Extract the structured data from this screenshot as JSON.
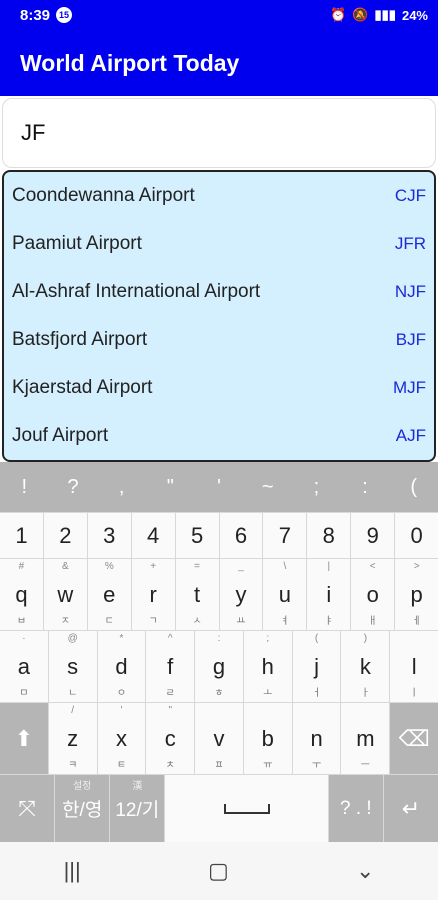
{
  "status": {
    "time": "8:39",
    "badge": "15",
    "battery": "24%"
  },
  "app": {
    "title": "World Airport Today"
  },
  "search": {
    "value": "JF"
  },
  "results": [
    {
      "name": "Coondewanna Airport",
      "code": "CJF"
    },
    {
      "name": "Paamiut Airport",
      "code": "JFR"
    },
    {
      "name": "Al-Ashraf International Airport",
      "code": "NJF"
    },
    {
      "name": "Batsfjord Airport",
      "code": "BJF"
    },
    {
      "name": "Kjaerstad Airport",
      "code": "MJF"
    },
    {
      "name": "Jouf Airport",
      "code": "AJF"
    }
  ],
  "keyboard": {
    "symbols": [
      "!",
      "?",
      ",",
      "\"",
      "'",
      "~",
      ";",
      ":",
      "("
    ],
    "numbers": [
      "1",
      "2",
      "3",
      "4",
      "5",
      "6",
      "7",
      "8",
      "9",
      "0"
    ],
    "row_q": [
      {
        "k": "q",
        "sup": "#",
        "sub": "ㅂ"
      },
      {
        "k": "w",
        "sup": "&",
        "sub": "ㅈ"
      },
      {
        "k": "e",
        "sup": "%",
        "sub": "ㄷ"
      },
      {
        "k": "r",
        "sup": "+",
        "sub": "ㄱ"
      },
      {
        "k": "t",
        "sup": "=",
        "sub": "ㅅ"
      },
      {
        "k": "y",
        "sup": "_",
        "sub": "ㅛ"
      },
      {
        "k": "u",
        "sup": "\\",
        "sub": "ㅕ"
      },
      {
        "k": "i",
        "sup": "|",
        "sub": "ㅑ"
      },
      {
        "k": "o",
        "sup": "<",
        "sub": "ㅐ"
      },
      {
        "k": "p",
        "sup": ">",
        "sub": "ㅔ"
      }
    ],
    "row_a": [
      {
        "k": "a",
        "sup": "·",
        "sub": "ㅁ"
      },
      {
        "k": "s",
        "sup": "@",
        "sub": "ㄴ"
      },
      {
        "k": "d",
        "sup": "*",
        "sub": "ㅇ"
      },
      {
        "k": "f",
        "sup": "^",
        "sub": "ㄹ"
      },
      {
        "k": "g",
        "sup": ":",
        "sub": "ㅎ"
      },
      {
        "k": "h",
        "sup": ";",
        "sub": "ㅗ"
      },
      {
        "k": "j",
        "sup": "(",
        "sub": "ㅓ"
      },
      {
        "k": "k",
        "sup": ")",
        "sub": "ㅏ"
      },
      {
        "k": "l",
        "sup": "",
        "sub": "ㅣ"
      }
    ],
    "row_z": [
      {
        "k": "z",
        "sup": "/",
        "sub": "ㅋ"
      },
      {
        "k": "x",
        "sup": "'",
        "sub": "ㅌ"
      },
      {
        "k": "c",
        "sup": "\"",
        "sub": "ㅊ"
      },
      {
        "k": "v",
        "sup": "",
        "sub": "ㅍ"
      },
      {
        "k": "b",
        "sup": "",
        "sub": "ㅠ"
      },
      {
        "k": "n",
        "sup": "",
        "sub": "ㅜ"
      },
      {
        "k": "m",
        "sup": "",
        "sub": "ㅡ"
      }
    ],
    "lang_key": {
      "top": "설정",
      "label": "한/영"
    },
    "num_key": {
      "top": "漢",
      "label": "12/기"
    },
    "punct_key": "? . !"
  }
}
